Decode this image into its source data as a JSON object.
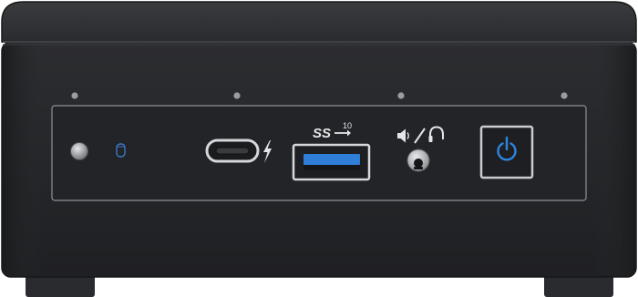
{
  "device": {
    "ports": {
      "usb_label": "SS",
      "usb_speed": "10"
    },
    "colors": {
      "chassis": "#2a2b2e",
      "lid": "#2d2e31",
      "panel": "#232427",
      "usb_tongue": "#2f7fd8",
      "power_led": "#2e86e0",
      "hdd_led": "#3a78c9",
      "trim": "#c9cbcf"
    },
    "icons": [
      "infrared-sensor-icon",
      "hdd-activity-icon",
      "thunderbolt-icon",
      "usb-superspeed-icon",
      "speaker-icon",
      "headphone-icon",
      "power-icon"
    ]
  }
}
